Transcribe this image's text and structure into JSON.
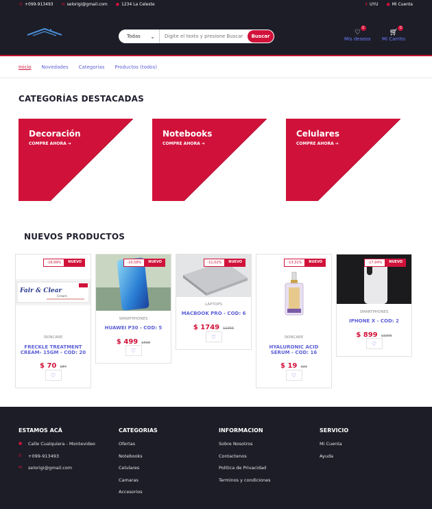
{
  "topbar": {
    "phone": "+099-913493",
    "email": "selorigi@gmail.com",
    "address": "1234 La Celeste",
    "currency": "UYU",
    "account": "Mi Cuenta"
  },
  "header": {
    "search": {
      "category": "Todas",
      "placeholder": "Digite el texto y presione Buscar",
      "button": "Buscar"
    },
    "wishlist": {
      "label": "Mis deseos",
      "count": "0"
    },
    "cart": {
      "label": "Mi Carrito",
      "count": "0"
    }
  },
  "nav": [
    "Inicio",
    "Novedades",
    "Categorias",
    "Productos (todos)"
  ],
  "featured": {
    "title": "CATEGORÍAS DESTACADAS",
    "cta": "COMPRE AHORA",
    "items": [
      "Decoración",
      "Notebooks",
      "Celulares"
    ]
  },
  "new_products": {
    "title": "NUEVOS PRODUCTOS",
    "new_label": "NUEVO",
    "items": [
      {
        "discount": "-16,99%",
        "category": "SKINCARE",
        "name": "FRECKLE TREATMENT CREAM- 15GM - COD: 20",
        "price": "$ 70",
        "old_price": "$84"
      },
      {
        "discount": "-10,58%",
        "category": "SMARTPHONES",
        "name": "HUAWEI P30 - COD: 5",
        "price": "$ 499",
        "old_price": "$558"
      },
      {
        "discount": "-11,02%",
        "category": "LAPTOPS",
        "name": "MACBOOK PRO - COD: 6",
        "price": "$ 1749",
        "old_price": "$1966"
      },
      {
        "discount": "-13,31%",
        "category": "SKINCARE",
        "name": "HYALURONIC ACID SERUM - COD: 16",
        "price": "$ 19",
        "old_price": "$22"
      },
      {
        "discount": "-17,94%",
        "category": "SMARTPHONES",
        "name": "IPHONE X - COD: 2",
        "price": "$ 899",
        "old_price": "$1096"
      }
    ]
  },
  "footer": {
    "columns": [
      {
        "title": "ESTAMOS ACÁ",
        "items": [
          "Calle Cualquiera - Montevideo",
          "+099-913493",
          "selorigi@gmail.com"
        ]
      },
      {
        "title": "CATEGORIAS",
        "items": [
          "Ofertas",
          "Notebooks",
          "Celulares",
          "Camaras",
          "Accesorios"
        ]
      },
      {
        "title": "INFORMACION",
        "items": [
          "Sobre Nosotros",
          "Contactenos",
          "Politica de Privacidad",
          "Terminos y condiciones"
        ]
      },
      {
        "title": "SERVICIO",
        "items": [
          "Mi Cuenta",
          "Ayuda"
        ]
      }
    ]
  },
  "colors": {
    "accent": "#d0123a",
    "dark": "#1c1d27",
    "link": "#5b5fd6"
  },
  "product_image_text": {
    "label": "Fair & Clear",
    "sub": "Cream"
  }
}
